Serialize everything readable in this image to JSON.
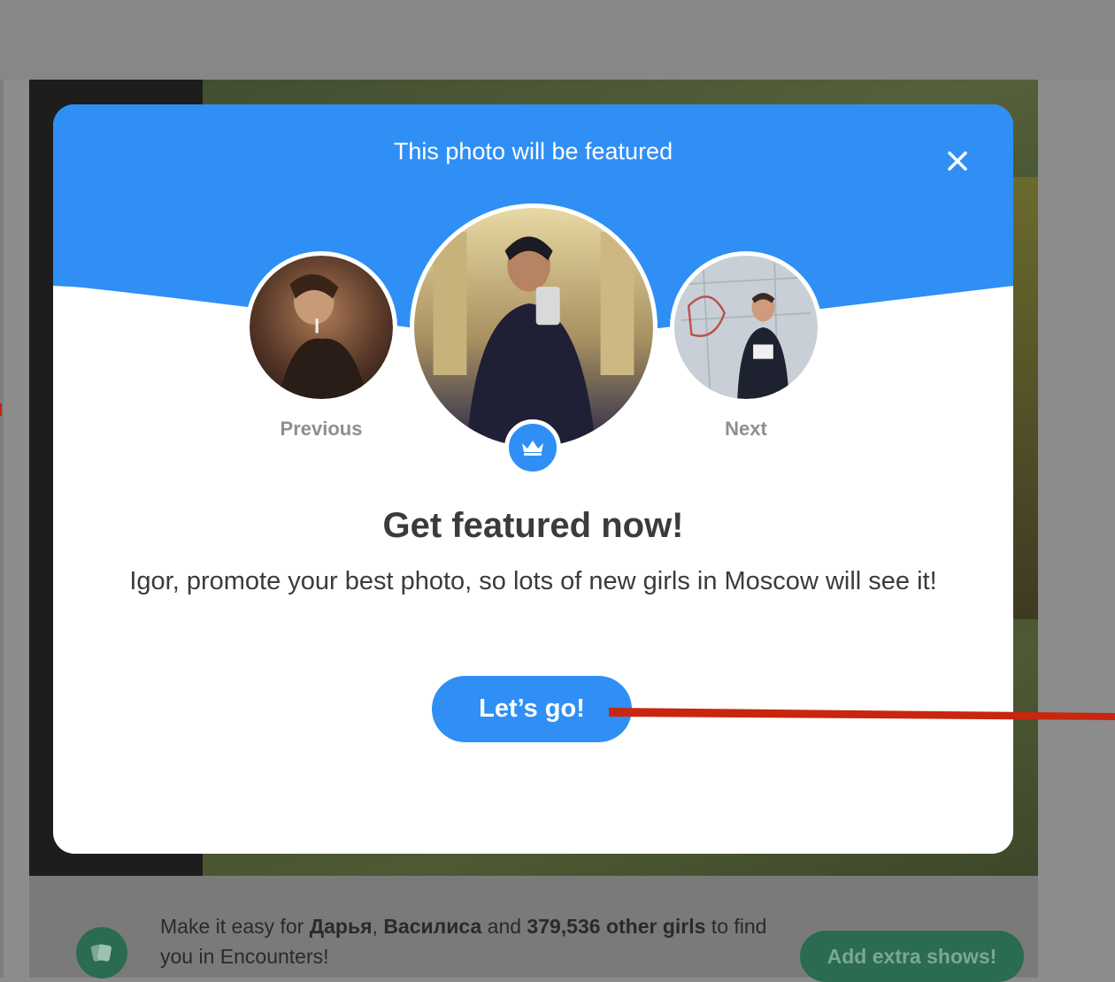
{
  "modal": {
    "title": "This photo will be featured",
    "previous_label": "Previous",
    "next_label": "Next",
    "heading": "Get featured now!",
    "body": "Igor, promote your best photo, so lots of new girls in Moscow will see it!",
    "cta_label": "Let’s go!",
    "accent_color": "#2f8ff5"
  },
  "bottom_bar": {
    "text_prefix": "Make it easy for ",
    "name_1": "Дарья",
    "separator": ", ",
    "name_2": "Василиса",
    "text_mid": " and ",
    "count_text": "379,536 other girls",
    "text_suffix": " to find you in Encounters!",
    "button_label": "Add extra shows!",
    "accent_color": "#2b6b4f"
  },
  "icons": {
    "close": "close-icon",
    "crown": "crown-icon",
    "encounters": "encounters-icon"
  },
  "annotation": {
    "arrow_color": "#c8260f"
  }
}
